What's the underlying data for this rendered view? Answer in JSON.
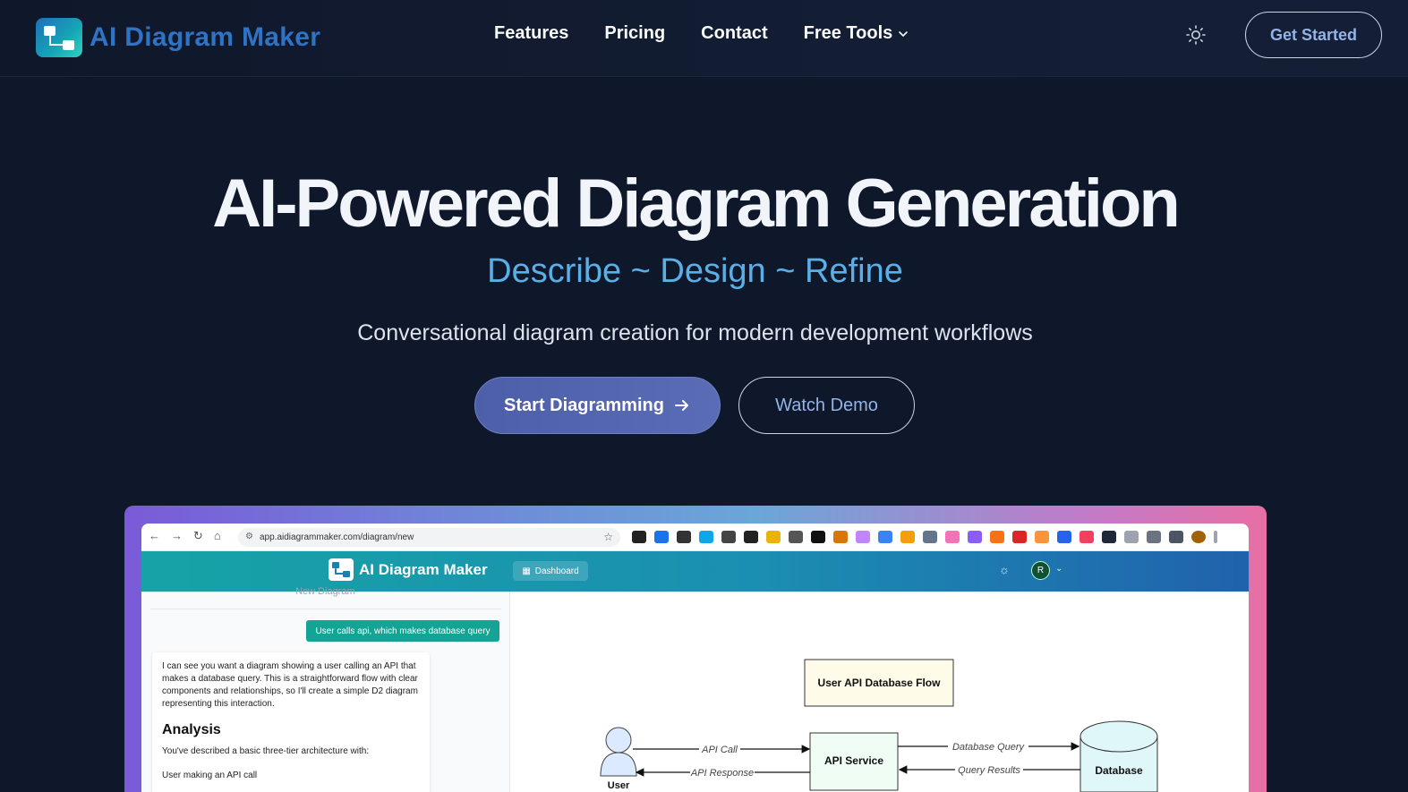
{
  "header": {
    "brand": "AI Diagram Maker",
    "nav": [
      {
        "label": "Features"
      },
      {
        "label": "Pricing"
      },
      {
        "label": "Contact"
      },
      {
        "label": "Free Tools"
      }
    ],
    "cta": "Get Started",
    "icons": {
      "theme": "sun-icon",
      "dropdown": "chevron-down-icon"
    }
  },
  "hero": {
    "title": "AI-Powered Diagram Generation",
    "subtitle": "Describe ~ Design ~ Refine",
    "description": "Conversational diagram creation for modern development workflows",
    "primary_button": "Start Diagramming",
    "secondary_button": "Watch Demo",
    "colors": {
      "accent": "#5ab0e6",
      "background": "#0f172a",
      "primary_button": "#5a6cb5"
    }
  },
  "preview": {
    "url": "app.aidiagrammaker.com/diagram/new",
    "app_brand": "AI Diagram Maker",
    "dashboard_label": "Dashboard",
    "avatar_initial": "R",
    "chat": {
      "header": "New Diagram",
      "user_message": "User calls api, which makes database query",
      "ai_intro": "I can see you want a diagram showing a user calling an API that makes a database query. This is a straightforward flow with clear components and relationships, so I'll create a simple D2 diagram representing this interaction.",
      "analysis_heading": "Analysis",
      "analysis_text": "You've described a basic three-tier architecture with:",
      "bullet_1": "User making an API call"
    },
    "diagram": {
      "title": "User API Database Flow",
      "nodes": {
        "user": "User",
        "api": "API Service",
        "db": "Database"
      },
      "edges": {
        "api_call": "API Call",
        "api_response": "API Response",
        "db_query": "Database Query",
        "query_results": "Query Results"
      }
    }
  }
}
